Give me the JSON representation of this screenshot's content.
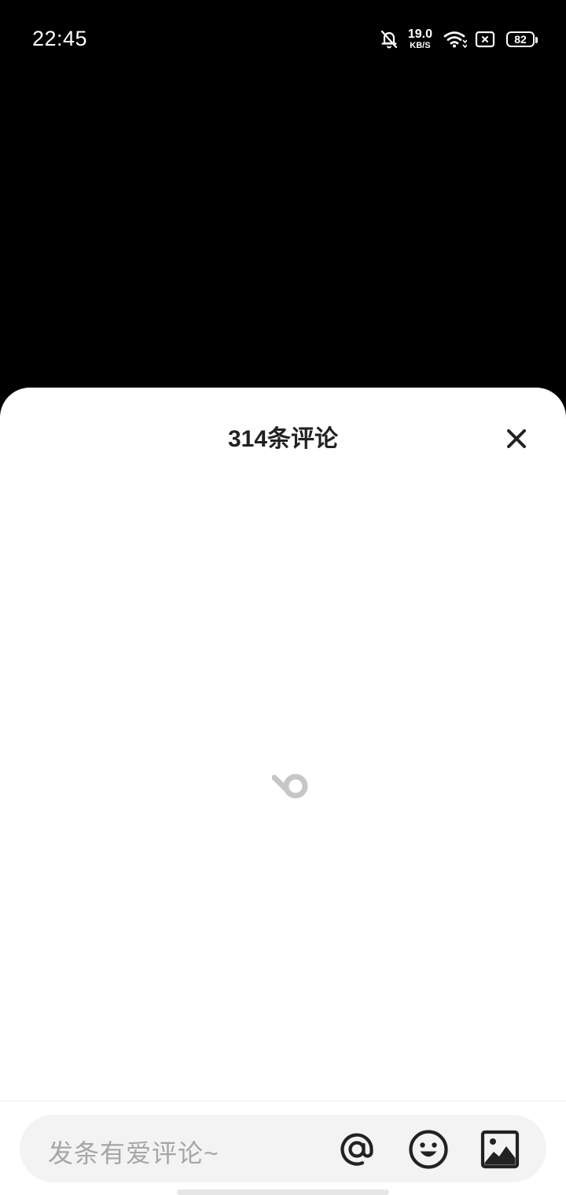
{
  "status_bar": {
    "time": "22:45",
    "net_speed_value": "19.0",
    "net_speed_unit": "KB/S",
    "battery": "82",
    "icons": [
      "bell-muted-icon",
      "wifi-icon",
      "sim-icon",
      "battery-icon"
    ]
  },
  "comments": {
    "title": "314条评论",
    "close_icon": "close-icon",
    "loading_icon": "loading-spinner-icon"
  },
  "composer": {
    "placeholder": "发条有爱评论~",
    "buttons": [
      "at-mention-icon",
      "emoji-icon",
      "image-icon"
    ]
  },
  "colors": {
    "background": "#000000",
    "sheet": "#ffffff",
    "input_bg": "#f3f3f3",
    "placeholder": "#a6a6a6",
    "icon": "#222222"
  }
}
